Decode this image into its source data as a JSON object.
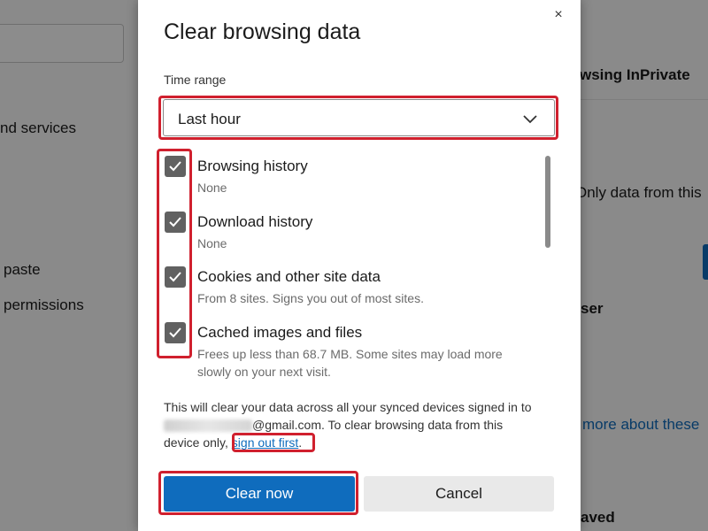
{
  "background": {
    "items": [
      {
        "text": "nd services"
      },
      {
        "text": "wsing InPrivate"
      },
      {
        "text": "Only data from this"
      },
      {
        "text": "paste"
      },
      {
        "text": "permissions"
      },
      {
        "text": "ser"
      },
      {
        "text": "more about these"
      },
      {
        "text": "aved"
      }
    ]
  },
  "dialog": {
    "title": "Clear browsing data",
    "close_glyph": "×",
    "time_range_label": "Time range",
    "time_range_value": "Last hour",
    "items": [
      {
        "label": "Browsing history",
        "desc": "None",
        "checked": true
      },
      {
        "label": "Download history",
        "desc": "None",
        "checked": true
      },
      {
        "label": "Cookies and other site data",
        "desc": "From 8 sites. Signs you out of most sites.",
        "checked": true
      },
      {
        "label": "Cached images and files",
        "desc": "Frees up less than 68.7 MB. Some sites may load more slowly on your next visit.",
        "checked": true
      }
    ],
    "sync": {
      "line1": "This will clear your data across all your synced devices signed in to",
      "email_suffix": "@gmail.com. To clear browsing data from this",
      "line3_prefix": "device only,",
      "link": "sign out first",
      "line3_suffix": "."
    },
    "clear_button": "Clear now",
    "cancel_button": "Cancel"
  },
  "colors": {
    "accent": "#0f6cbd",
    "checkbox": "#616161",
    "highlight": "#d0202e"
  }
}
